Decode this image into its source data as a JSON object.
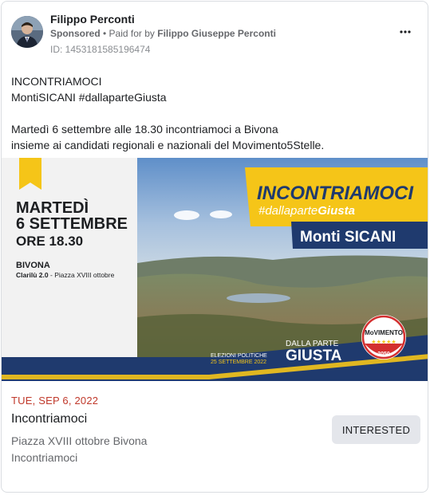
{
  "post": {
    "advertiser": "Filippo Perconti",
    "sponsored": "Sponsored",
    "separator": " • ",
    "paid_for_prefix": "Paid for by ",
    "payer": "Filippo Giuseppe Perconti",
    "ad_id": "ID: 1453181585196474",
    "text_lines": [
      "INCONTRIAMOCI",
      "MontiSICANI #dallaparteGiusta",
      "Martedì 6 settembre alle 18.30 incontriamoci a Bivona",
      "insieme ai candidati regionali e nazionali del Movimento5Stelle."
    ]
  },
  "banner": {
    "day": "MARTEDÌ",
    "date": "6 SETTEMBRE",
    "time": "ORE 18.30",
    "town": "BIVONA",
    "venue": "Clarilù 2.0",
    "venue_sep": " - ",
    "address": "Piazza XVIII ottobre",
    "headline": "INCONTRIAMOCI",
    "hashtag_prefix": "#dallaparte",
    "hashtag_suffix": "Giusta",
    "area": "Monti SICANI",
    "election_line1": "ELEZIONI POLITICHE",
    "election_line2": "25 SETTEMBRE 2022",
    "slogan_small": "DALLA PARTE",
    "slogan_big": "GIUSTA",
    "logo_text": "MoVIMENTO",
    "logo_year": "2050",
    "colors": {
      "yellow": "#f5c518",
      "navy": "#1f3a6e"
    }
  },
  "event": {
    "date": "TUE, SEP 6, 2022",
    "title": "Incontriamoci",
    "location_line1": "Piazza XVIII ottobre Bivona",
    "location_line2": "Incontriamoci",
    "button_label": "INTERESTED"
  }
}
